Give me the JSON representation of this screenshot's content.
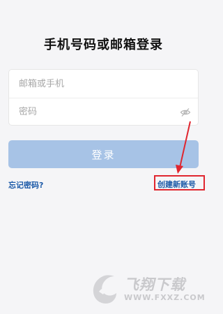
{
  "page": {
    "title": "手机号码或邮箱登录"
  },
  "form": {
    "email_placeholder": "邮箱或手机",
    "password_placeholder": "密码",
    "login_label": "登录"
  },
  "links": {
    "forgot_label": "忘记密码?",
    "register_label": "创建新账号"
  },
  "watermark": {
    "brand_cn": "飞翔下载",
    "brand_url": "WWW.FXXZ.COM"
  },
  "colors": {
    "background": "#f5f5f7",
    "login_button": "#a7c3e6",
    "link": "#1c5aa8",
    "annotation": "#e0262f"
  },
  "icons": {
    "password_toggle": "eye-off-icon"
  }
}
